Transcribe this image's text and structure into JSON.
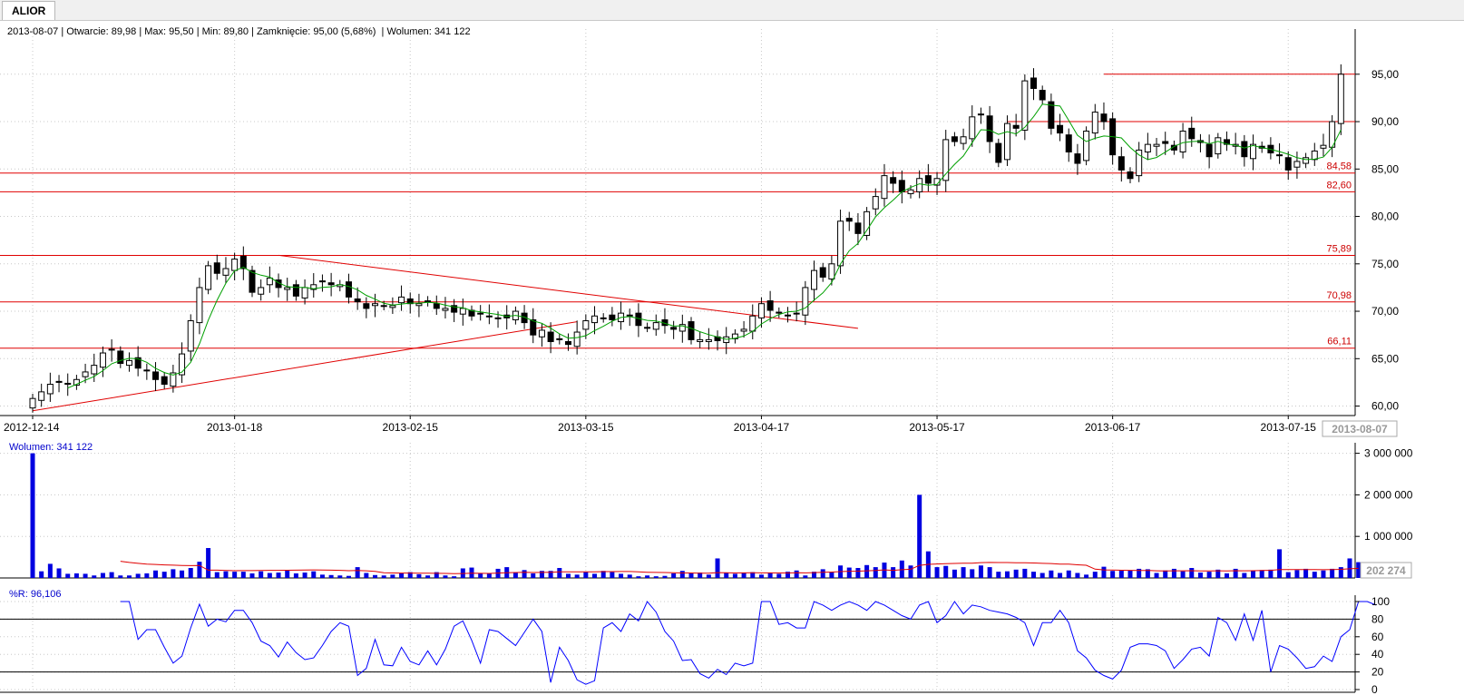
{
  "tab": {
    "label": "ALIOR"
  },
  "info": {
    "date": "2013-08-07",
    "open": "89,98",
    "max": "95,50",
    "min": "89,80",
    "close": "95,00 (5,68%)",
    "volume": "341 122",
    "text": "2013-08-07 | Otwarcie: 89,98 | Max: 95,50 | Min: 89,80 | Zamknięcie: 95,00 (5,68%)  | Wolumen: 341 122"
  },
  "volume_label": "Wolumen: 341 122",
  "wr_label": "%R: 96,106",
  "last_date": "2013-08-07",
  "last_volume_avg": "202 274",
  "colors": {
    "grid": "#c8c8c8",
    "level": "#e00000",
    "ma": "#00a000",
    "volume": "#0000e0",
    "wr": "#0000ff"
  },
  "chart_data": [
    {
      "type": "candlestick",
      "title": "ALIOR",
      "ylim": [
        59,
        99
      ],
      "y_ticks": [
        "60,00",
        "65,00",
        "70,00",
        "75,00",
        "80,00",
        "85,00",
        "90,00",
        "95,00"
      ],
      "x_ticks": [
        {
          "label": "2012-12-14",
          "index": 0
        },
        {
          "label": "2013-01-18",
          "index": 23
        },
        {
          "label": "2013-02-15",
          "index": 43
        },
        {
          "label": "2013-03-15",
          "index": 63
        },
        {
          "label": "2013-04-17",
          "index": 83
        },
        {
          "label": "2013-05-17",
          "index": 103
        },
        {
          "label": "2013-06-17",
          "index": 123
        },
        {
          "label": "2013-07-15",
          "index": 143
        }
      ],
      "closes": [
        60.8,
        61.5,
        62.3,
        62.5,
        62.4,
        62.8,
        63.6,
        64.3,
        65.6,
        66.0,
        64.5,
        64.8,
        64.0,
        63.8,
        62.8,
        62.3,
        63.5,
        65.5,
        69.0,
        72.5,
        74.8,
        74.0,
        74.5,
        75.5,
        74.5,
        72.0,
        72.5,
        73.5,
        72.5,
        72.5,
        71.6,
        72.5,
        72.8,
        73.2,
        72.8,
        72.8,
        71.5,
        71.0,
        70.3,
        70.8,
        70.6,
        70.6,
        71.5,
        70.8,
        70.8,
        71.0,
        70.3,
        70.3,
        69.9,
        70.3,
        69.5,
        69.7,
        69.5,
        69.3,
        69.3,
        70.0,
        68.8,
        67.5,
        68.0,
        66.8,
        67.0,
        66.5,
        67.8,
        69.0,
        69.5,
        69.3,
        69.1,
        69.8,
        69.5,
        68.5,
        68.3,
        68.8,
        68.5,
        68.1,
        68.6,
        67.0,
        67.0,
        67.0,
        66.9,
        67.3,
        67.6,
        68.1,
        69.5,
        70.8,
        70.1,
        69.8,
        69.5,
        69.8,
        72.5,
        74.3,
        73.6,
        75.0,
        79.5,
        79.5,
        78.2,
        80.5,
        82.1,
        84.3,
        83.5,
        82.6,
        82.8,
        84.0,
        83.5,
        84.0,
        88.1,
        87.9,
        88.4,
        90.5,
        90.8,
        87.9,
        85.7,
        89.8,
        89.3,
        94.3,
        93.5,
        92.3,
        89.3,
        88.8,
        86.8,
        85.6,
        89.0,
        91.0,
        90.0,
        86.5,
        84.9,
        84.0,
        87.0,
        87.6,
        87.6,
        87.7,
        87.0,
        89.0,
        88.2,
        87.8,
        86.3,
        88.3,
        87.6,
        87.6,
        86.3,
        87.6,
        87.2,
        86.7,
        86.4,
        84.9,
        85.8,
        86.2,
        86.9,
        87.5,
        90.0,
        95.0
      ],
      "ma_period": 5,
      "horizontal_levels": [
        {
          "value": 84.58,
          "label": "84,58"
        },
        {
          "value": 82.6,
          "label": "82,60"
        },
        {
          "value": 75.89,
          "label": "75,89"
        },
        {
          "value": 70.98,
          "label": "70,98"
        },
        {
          "value": 66.11,
          "label": "66,11"
        }
      ],
      "short_levels": [
        {
          "value": 95.0,
          "from_index": 122
        },
        {
          "value": 90.0,
          "from_index": 111
        }
      ],
      "trendlines": [
        {
          "from": [
            0,
            59.5
          ],
          "to": [
            62,
            68.9
          ]
        },
        {
          "from": [
            28,
            75.9
          ],
          "to": [
            94,
            68.2
          ]
        }
      ]
    },
    {
      "type": "bar",
      "title": "Wolumen",
      "ylim": [
        0,
        3100000
      ],
      "y_ticks": [
        "1 000 000",
        "2 000 000",
        "3 000 000"
      ],
      "values": [
        3000000,
        160000,
        340000,
        230000,
        100000,
        110000,
        100000,
        60000,
        120000,
        140000,
        60000,
        60000,
        100000,
        110000,
        180000,
        150000,
        210000,
        180000,
        240000,
        390000,
        720000,
        140000,
        160000,
        150000,
        150000,
        110000,
        160000,
        120000,
        130000,
        190000,
        110000,
        130000,
        160000,
        80000,
        70000,
        60000,
        50000,
        260000,
        120000,
        70000,
        60000,
        80000,
        110000,
        140000,
        90000,
        60000,
        140000,
        60000,
        40000,
        230000,
        250000,
        110000,
        120000,
        220000,
        260000,
        140000,
        190000,
        110000,
        170000,
        170000,
        240000,
        100000,
        80000,
        140000,
        100000,
        170000,
        140000,
        100000,
        80000,
        40000,
        60000,
        40000,
        50000,
        110000,
        170000,
        120000,
        130000,
        80000,
        470000,
        120000,
        100000,
        130000,
        140000,
        80000,
        130000,
        100000,
        150000,
        180000,
        60000,
        150000,
        210000,
        140000,
        300000,
        250000,
        240000,
        310000,
        260000,
        370000,
        260000,
        420000,
        300000,
        2000000,
        640000,
        260000,
        290000,
        200000,
        260000,
        210000,
        300000,
        260000,
        150000,
        160000,
        200000,
        220000,
        150000,
        120000,
        180000,
        120000,
        180000,
        120000,
        80000,
        150000,
        270000,
        170000,
        190000,
        180000,
        220000,
        210000,
        120000,
        180000,
        220000,
        160000,
        240000,
        130000,
        150000,
        200000,
        110000,
        220000,
        120000,
        170000,
        190000,
        200000,
        690000,
        140000,
        190000,
        220000,
        150000,
        180000,
        220000,
        260000,
        470000,
        380000
      ],
      "avg_period": 20
    },
    {
      "type": "line",
      "title": "%R",
      "ylim": [
        0,
        100
      ],
      "y_ticks": [
        "0",
        "20",
        "40",
        "60",
        "80",
        "100"
      ],
      "start_index": 10,
      "values": [
        100,
        100,
        57,
        68,
        68,
        48,
        30,
        38,
        70,
        97,
        72,
        80,
        77,
        90,
        90,
        76,
        55,
        50,
        37,
        54,
        42,
        34,
        36,
        50,
        66,
        76,
        72,
        16,
        24,
        57,
        28,
        27,
        48,
        32,
        28,
        44,
        28,
        46,
        72,
        78,
        56,
        30,
        68,
        66,
        58,
        50,
        65,
        80,
        66,
        8,
        48,
        33,
        11,
        6,
        10,
        70,
        76,
        66,
        86,
        78,
        100,
        88,
        66,
        55,
        33,
        34,
        18,
        13,
        23,
        17,
        30,
        27,
        30,
        100,
        100,
        74,
        76,
        70,
        70,
        100,
        96,
        90,
        96,
        100,
        96,
        90,
        100,
        96,
        90,
        84,
        80,
        96,
        100,
        76,
        84,
        100,
        86,
        96,
        94,
        90,
        88,
        86,
        82,
        76,
        50,
        76,
        76,
        90,
        76,
        44,
        36,
        22,
        16,
        12,
        22,
        48,
        52,
        52,
        50,
        44,
        24,
        34,
        46,
        48,
        38,
        82,
        76,
        56,
        86,
        56,
        90,
        20,
        50,
        46,
        36,
        24,
        26,
        38,
        32,
        60,
        68,
        100,
        100,
        96
      ]
    }
  ]
}
